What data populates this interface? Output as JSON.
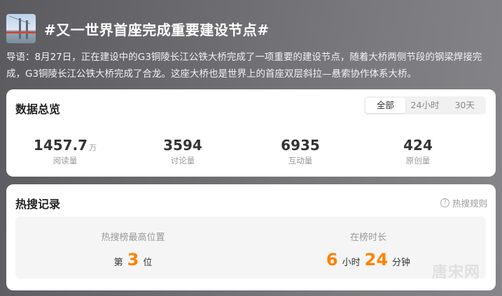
{
  "header": {
    "title": "#又一世界首座完成重要建设节点#"
  },
  "intro": {
    "text": "导语：8月27日，正在建设中的G3铜陵长江公铁大桥完成了一项重要的建设节点，随着大桥两侧节段的钢梁焊接完成，G3铜陵长江公铁大桥完成了合龙。这座大桥也是世界上的首座双层斜拉—悬索协作体系大桥。"
  },
  "overview": {
    "title": "数据总览",
    "tabs": [
      "全部",
      "24小时",
      "30天"
    ],
    "active_tab": "全部",
    "stats": [
      {
        "value": "1457.7",
        "unit": "万",
        "label": "阅读量"
      },
      {
        "value": "3594",
        "unit": "",
        "label": "讨论量"
      },
      {
        "value": "6935",
        "unit": "",
        "label": "互动量"
      },
      {
        "value": "424",
        "unit": "",
        "label": "原创量"
      }
    ]
  },
  "hot_record": {
    "title": "热搜记录",
    "rule_link": "热搜规则",
    "peak": {
      "label": "热搜榜最高位置",
      "prefix": "第",
      "value": "3",
      "suffix": "位"
    },
    "duration": {
      "label": "在榜时长",
      "hours": "6",
      "hours_unit": "小时",
      "minutes": "24",
      "minutes_unit": "分钟"
    },
    "accent_color": "#ff8200"
  },
  "watermark": "唐宋网"
}
